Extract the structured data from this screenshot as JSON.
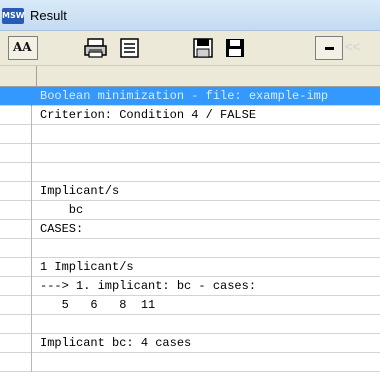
{
  "window": {
    "title": "Result",
    "icon_text": "MSW"
  },
  "toolbar": {
    "font_label": "AA",
    "nav_label": "<<"
  },
  "lines": [
    "Boolean minimization - file: example-imp",
    "Criterion: Condition 4 / FALSE",
    "",
    "",
    "",
    "Implicant/s",
    "    bc",
    "CASES:",
    "",
    "1 Implicant/s",
    "---> 1. implicant: bc - cases:",
    "   5   6   8  11",
    "",
    "Implicant bc: 4 cases",
    ""
  ],
  "colors": {
    "selection": "#3399ff",
    "toolbar_bg": "#ece9d8"
  }
}
